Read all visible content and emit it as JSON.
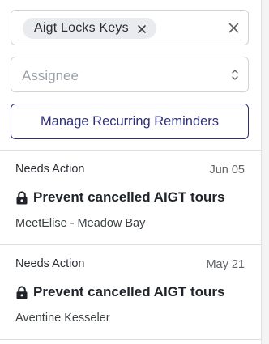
{
  "filters": {
    "active_chip_label": "Aigt Locks Keys",
    "assignee_placeholder": "Assignee"
  },
  "actions": {
    "manage_reminders_label": "Manage Recurring Reminders"
  },
  "reminders": [
    {
      "status": "Needs Action",
      "date": "Jun 05",
      "title": "Prevent cancelled AIGT tours",
      "subtitle": "MeetElise - Meadow Bay",
      "icon": "lock-icon"
    },
    {
      "status": "Needs Action",
      "date": "May 21",
      "title": "Prevent cancelled AIGT tours",
      "subtitle": "Aventine Kesseler",
      "icon": "lock-icon"
    }
  ],
  "colors": {
    "accent": "#2f2f7a",
    "chip_background": "#e9ebee",
    "border": "#cfd3d8",
    "divider": "#dcdfe3"
  }
}
